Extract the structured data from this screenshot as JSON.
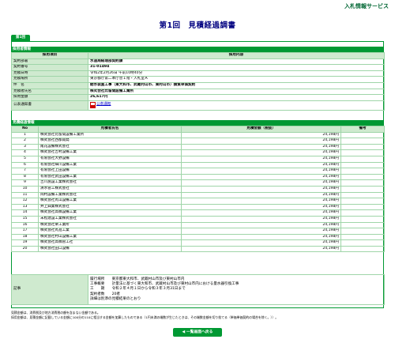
{
  "header": {
    "service_link": "入札情報サービス",
    "page_title": "第1回　見積経過調書",
    "tab_label": "第1回"
  },
  "procurer": {
    "section_title": "採用者情報",
    "col_item": "採用項目",
    "col_content": "採用内容",
    "rows": [
      {
        "label": "契約部署",
        "value": "水道局経理部契約課"
      },
      {
        "label": "契約番号",
        "value": "31-01494"
      },
      {
        "label": "見積日時",
        "value": "令和2年2月26日 午前10時40分"
      },
      {
        "label": "見積場所",
        "value": "東京都庁第二本庁舎１階・入札室Ａ"
      },
      {
        "label": "件　名",
        "value": "給水装置工事（東大和市、武蔵村山市、東村山市）請負単価契約"
      },
      {
        "label": "見積者氏名",
        "value": "株式会社比留間設備工業所"
      },
      {
        "label": "採用金額",
        "value": "26,617円"
      }
    ],
    "notice_label": "公表通知書",
    "notice_link": "公表通知"
  },
  "bids": {
    "section_title": "見積経過情報",
    "col_no": "No",
    "col_name": "見積者氏名",
    "col_amount": "見積金額（税抜）",
    "col_note": "備考",
    "rows": [
      {
        "no": "1",
        "name": "株式会社比留間設備工業所",
        "amount": "24,198円",
        "note": ""
      },
      {
        "no": "2",
        "name": "株式会社西都開発",
        "amount": "24,198円",
        "note": ""
      },
      {
        "no": "3",
        "name": "尾花設備株式会社",
        "amount": "24,198円",
        "note": ""
      },
      {
        "no": "4",
        "name": "株式会社吉村設備工業",
        "amount": "24,198円",
        "note": ""
      },
      {
        "no": "5",
        "name": "有限会社大野設備",
        "amount": "24,198円",
        "note": ""
      },
      {
        "no": "6",
        "name": "有限会社細川設備工業",
        "amount": "24,198円",
        "note": ""
      },
      {
        "no": "7",
        "name": "有限会社上田設備",
        "amount": "24,198円",
        "note": ""
      },
      {
        "no": "8",
        "name": "有限会社武田設備工業",
        "amount": "24,198円",
        "note": ""
      },
      {
        "no": "9",
        "name": "吉川施設工業株式会社",
        "amount": "24,198円",
        "note": ""
      },
      {
        "no": "10",
        "name": "清水管工株式会社",
        "amount": "24,198円",
        "note": ""
      },
      {
        "no": "11",
        "name": "岡村設備工業株式会社",
        "amount": "24,198円",
        "note": ""
      },
      {
        "no": "12",
        "name": "株式会社丸山設備工業",
        "amount": "24,198円",
        "note": ""
      },
      {
        "no": "13",
        "name": "井上興業株式会社",
        "amount": "24,198円",
        "note": ""
      },
      {
        "no": "14",
        "name": "株式会社高橋設備工業",
        "amount": "24,198円",
        "note": ""
      },
      {
        "no": "15",
        "name": "末松建設工業株式会社",
        "amount": "24,198円",
        "note": ""
      },
      {
        "no": "16",
        "name": "株式会社栗工業所",
        "amount": "24,198円",
        "note": ""
      },
      {
        "no": "17",
        "name": "株式会社丸進工業",
        "amount": "24,198円",
        "note": ""
      },
      {
        "no": "18",
        "name": "株式会社村山設備工業",
        "amount": "24,198円",
        "note": ""
      },
      {
        "no": "19",
        "name": "株式会社高橋管工社",
        "amount": "24,198円",
        "note": ""
      },
      {
        "no": "20",
        "name": "株式会社田口設備",
        "amount": "24,198円",
        "note": ""
      }
    ]
  },
  "remarks": {
    "label": "記事",
    "text": "履行場所　　東京都東大和市、武蔵村山市及び東村山市内\n工事概要　　計量法に基づく東大和市、武蔵村山市及び東村山市内における量水器引換工事\n工　　期　　令和２年４月１日から令和３年３月31日まで\n契約者数　　20者\n詳細は別添の見積結果のとおり"
  },
  "notes": {
    "line1": "見積金額は、消費税及び地方消費税の額を含まない金額である。",
    "line2": "採用金額は、見積金額に記載している金額に100分の110に相当する金額を加算したものである（1円未満の端数が生じたときは、その端数金額を切り捨てる（単価単価契約の場合を除く。））。"
  },
  "buttons": {
    "back": "◀ 一覧画面へ戻る"
  },
  "colors": {
    "accent_green": "#009933",
    "title_navy": "#000080",
    "label_bg": "#cfeacf"
  }
}
